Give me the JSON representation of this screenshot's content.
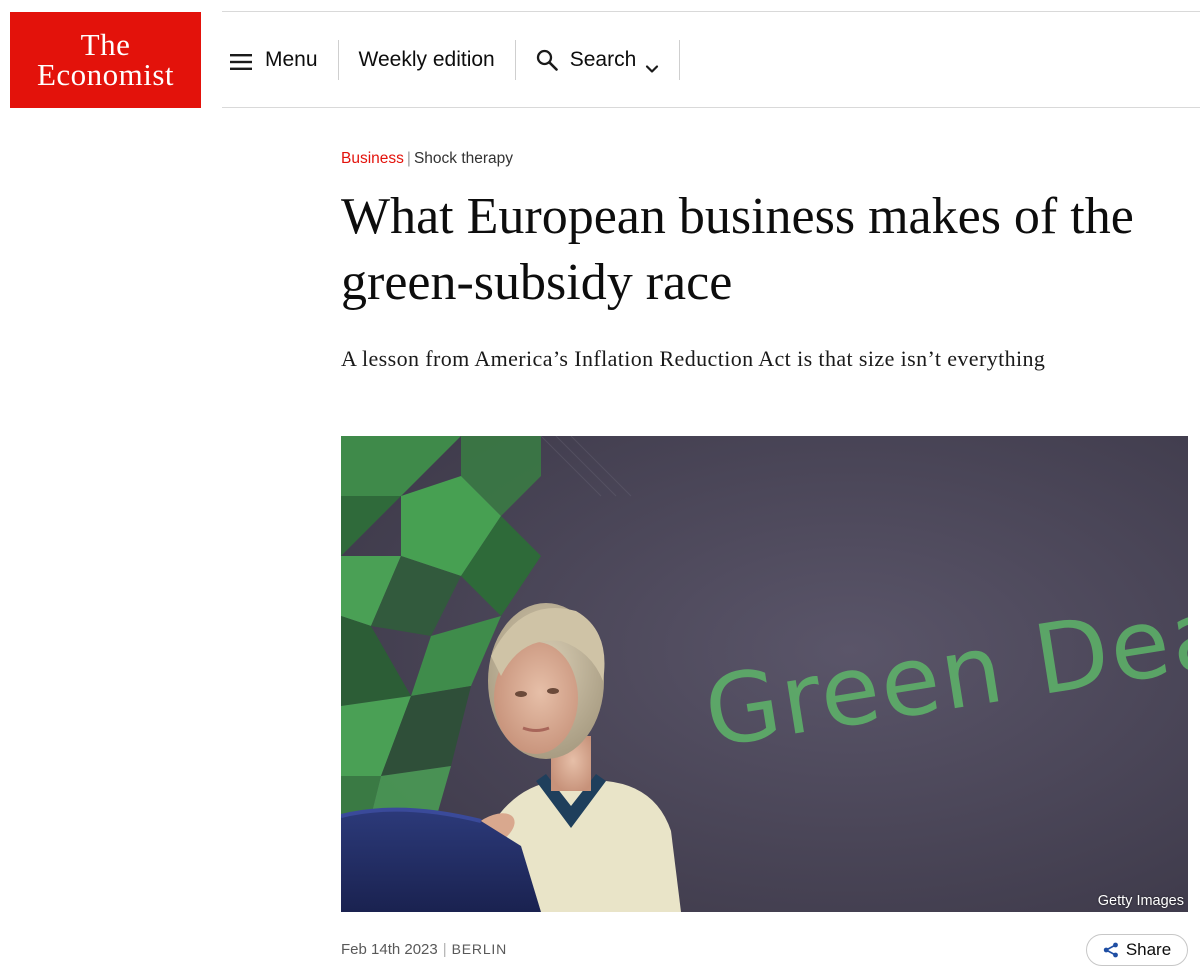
{
  "brand": {
    "logo_line1": "The",
    "logo_line2": "Economist",
    "color": "#e3120b"
  },
  "nav": {
    "menu_label": "Menu",
    "menu_icon": "hamburger-icon",
    "weekly_label": "Weekly edition",
    "search_label": "Search",
    "search_icon": "search-icon",
    "search_caret": "chevron-down-icon"
  },
  "article": {
    "section": "Business",
    "separator": "|",
    "fly_title": "Shock therapy",
    "headline": "What European business makes of the green-subsidy race",
    "subheadline": "A lesson from America’s Inflation Reduction Act is that size isn’t everything",
    "image": {
      "backdrop_text": "Green Deal",
      "credit": "Getty Images"
    },
    "date": "Feb 14th 2023",
    "date_separator": "|",
    "place": "BERLIN"
  },
  "share": {
    "label": "Share",
    "icon": "share-icon"
  }
}
